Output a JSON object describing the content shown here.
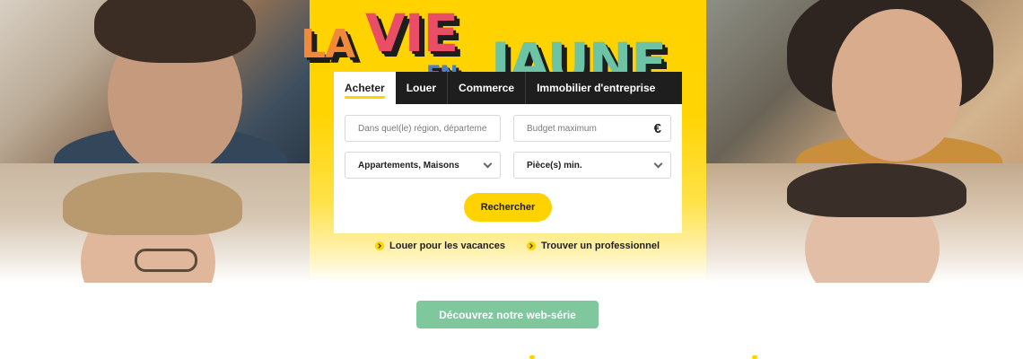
{
  "logo": {
    "la": "LA",
    "vie": "VIE",
    "en": "EN",
    "jaune": "JAUNE"
  },
  "search": {
    "tabs": [
      {
        "label": "Acheter",
        "active": true
      },
      {
        "label": "Louer",
        "active": false
      },
      {
        "label": "Commerce",
        "active": false
      },
      {
        "label": "Immobilier d'entreprise",
        "active": false
      }
    ],
    "location_placeholder": "Dans quel(le) région, départeme",
    "budget_placeholder": "Budget maximum",
    "currency_symbol": "€",
    "property_type_value": "Appartements, Maisons",
    "rooms_value": "Pièce(s) min.",
    "submit_label": "Rechercher"
  },
  "quick_links": [
    {
      "label": "Louer pour les vacances"
    },
    {
      "label": "Trouver un professionnel"
    }
  ],
  "webserie_button": "Découvrez notre web-série",
  "colors": {
    "brand_yellow": "#ffd200",
    "dark": "#1e1e1e",
    "green": "#7fc79d"
  },
  "icons": [
    "euro-icon",
    "chevron-down-icon",
    "arrow-circle-icon"
  ]
}
